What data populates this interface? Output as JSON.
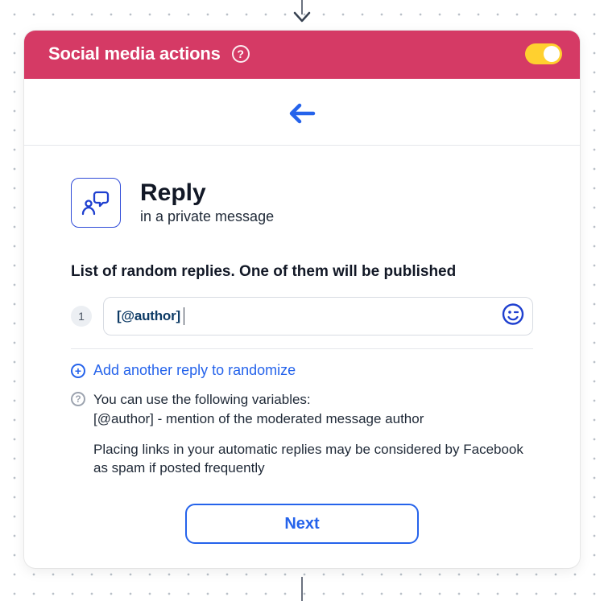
{
  "header": {
    "title": "Social media actions",
    "toggle_on": true
  },
  "reply": {
    "title": "Reply",
    "subtitle": "in a private message"
  },
  "section_heading": "List of random replies. One of them will be published",
  "replies": {
    "0": {
      "index": "1",
      "value": "[@author]"
    }
  },
  "add_reply_label": "Add another reply to randomize",
  "help": {
    "line1": "You can use the following variables:",
    "line2": "[@author] - mention of the moderated message author",
    "line3": "Placing links in your automatic replies may be considered by Facebook as spam if posted frequently"
  },
  "next_label": "Next"
}
